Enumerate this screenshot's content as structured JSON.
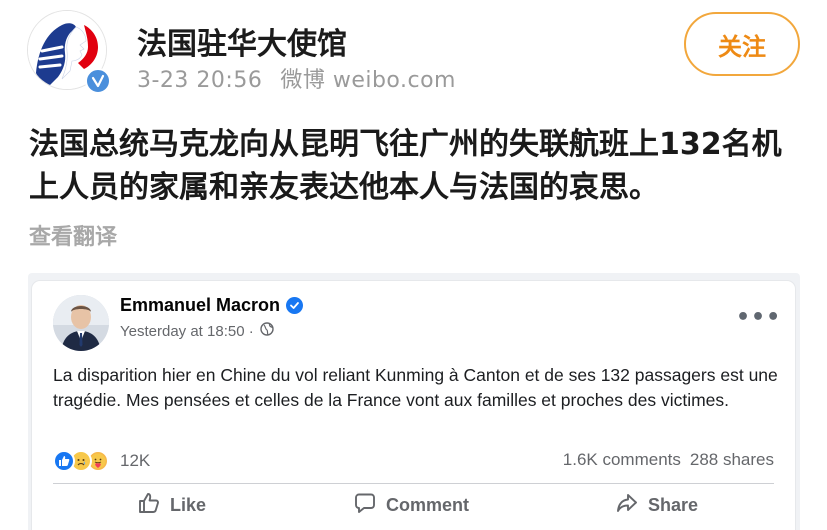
{
  "weibo": {
    "account_name": "法国驻华大使馆",
    "post_date": "3-23 20:56",
    "post_source": "微博 weibo.com",
    "follow_label": "关注",
    "post_text": "法国总统马克龙向从昆明飞往广州的失联航班上132名机上人员的家属和亲友表达他本人与法国的哀思。",
    "translate_label": "查看翻译",
    "icons": {
      "avatar": "french-embassy-logo-icon",
      "verified": "verified-badge-icon"
    },
    "colors": {
      "follow_accent": "#ee8a14",
      "verified_blue": "#4a8fdc"
    }
  },
  "facebook_post": {
    "author": "Emmanuel Macron",
    "timestamp": "Yesterday at 18:50 · ",
    "text": "La disparition hier en Chine du vol reliant Kunming à Canton et de ses 132 passagers est une tragédie. Mes pensées et celles de la France vont aux familles et proches des victimes.",
    "reaction_count": "12K",
    "comments": "1.6K comments",
    "shares": "288 shares",
    "more_label": "•••",
    "actions": {
      "like": "Like",
      "comment": "Comment",
      "share": "Share"
    },
    "icons": {
      "verified": "verified-check-icon",
      "audience": "globe-icon",
      "reactions": [
        "like-reaction-icon",
        "sad-reaction-icon",
        "care-reaction-icon"
      ],
      "like": "thumbs-up-icon",
      "comment": "comment-bubble-icon",
      "share": "share-arrow-icon"
    },
    "colors": {
      "brand_blue": "#1877f2",
      "secondary_text": "#65676b"
    }
  }
}
